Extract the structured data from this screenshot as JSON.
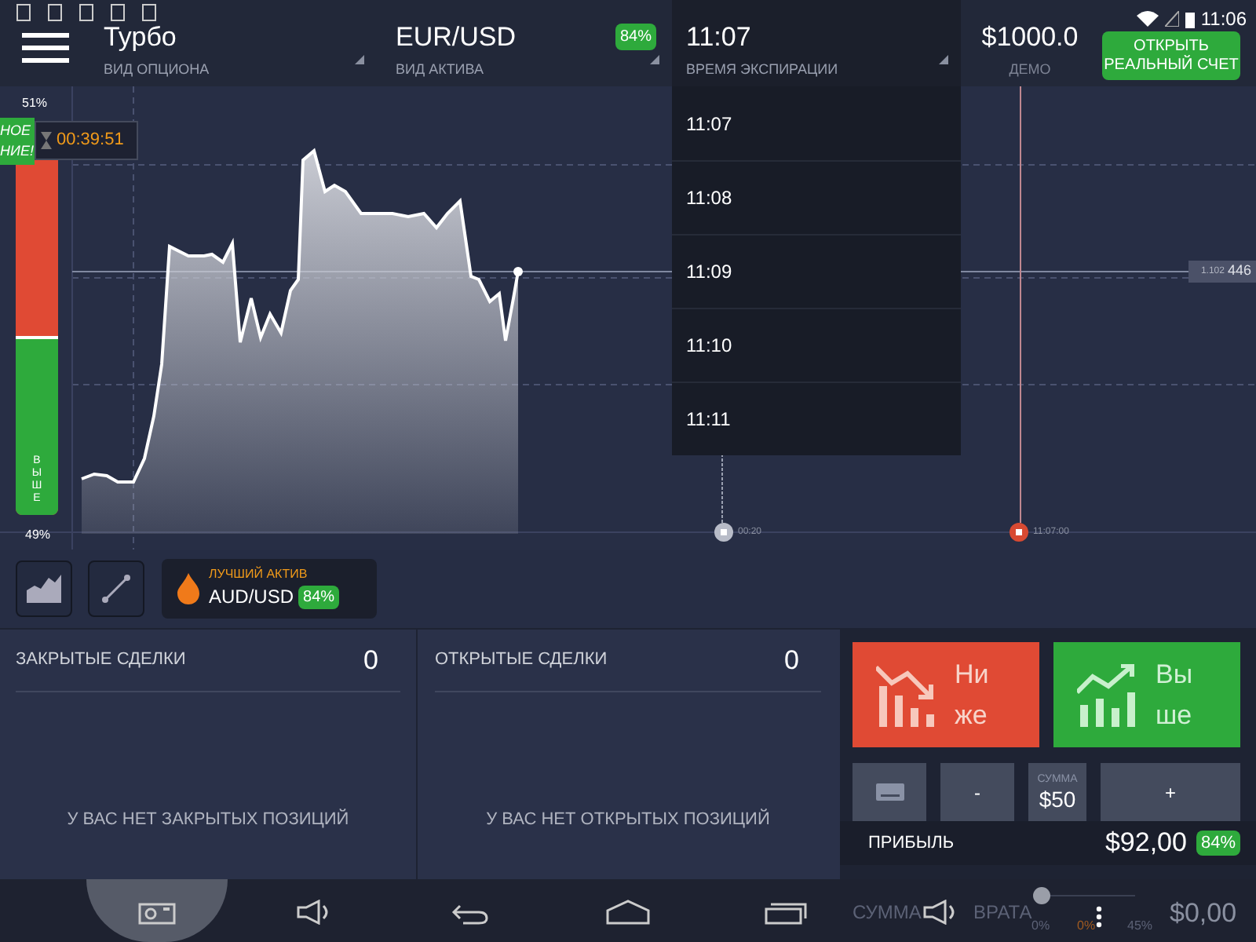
{
  "status_bar": {
    "time": "11:06"
  },
  "header": {
    "option_type": {
      "value": "Турбо",
      "label": "ВИД ОПЦИОНА"
    },
    "asset": {
      "value": "EUR/USD",
      "label": "ВИД АКТИВА",
      "payout": "84%"
    },
    "expiration": {
      "value": "11:07",
      "label": "ВРЕМЯ ЭКСПИРАЦИИ",
      "expanded": true,
      "options": [
        {
          "label": "11:07"
        },
        {
          "label": "11:08"
        },
        {
          "label": "11:09"
        },
        {
          "label": "11:10"
        },
        {
          "label": "11:11"
        }
      ]
    },
    "balance": {
      "value": "$1000.0",
      "label": "ДЕМО"
    },
    "open_account_button": "ОТКРЫТЬ РЕАЛЬНЫЙ СЧЕТ"
  },
  "sentiment": {
    "top_percent": "51%",
    "bottom_percent": "49%",
    "bottom_label": "ВЫШЕ",
    "level": 0.49
  },
  "promo_badge": {
    "lines": [
      "НОЕ",
      "НИЕ!"
    ]
  },
  "timer": "00:39:51",
  "chart": {
    "price_tag": {
      "small": "1.102",
      "large": "446"
    },
    "markers": [
      {
        "kind": "start",
        "label": "00:20"
      },
      {
        "kind": "finish",
        "label": "11:07:00"
      }
    ]
  },
  "best_asset": {
    "label": "ЛУЧШИЙ АКТИВ",
    "asset": "AUD/USD",
    "payout": "84%"
  },
  "closed_trades": {
    "title": "ЗАКРЫТЫЕ СДЕЛКИ",
    "count": "0",
    "empty": "У ВАС НЕТ ЗАКРЫТЫХ ПОЗИЦИЙ"
  },
  "open_trades": {
    "title": "ОТКРЫТЫЕ СДЕЛКИ",
    "count": "0",
    "empty": "У ВАС НЕТ ОТКРЫТЫХ ПОЗИЦИЙ"
  },
  "trade": {
    "down_button": [
      "Ни",
      "же"
    ],
    "up_button": [
      "Вы",
      "ше"
    ],
    "minus": "-",
    "plus": "+",
    "amount_label": "СУММА",
    "amount": "$50",
    "profit_label": "ПРИБЫЛЬ",
    "profit": "$92,00",
    "profit_percent": "84%"
  },
  "return": {
    "label_parts": [
      "СУММА",
      "ВРАТА"
    ],
    "level": 0,
    "ticks": [
      "0%",
      "0%",
      "45%"
    ],
    "amount": "$0,00"
  }
}
